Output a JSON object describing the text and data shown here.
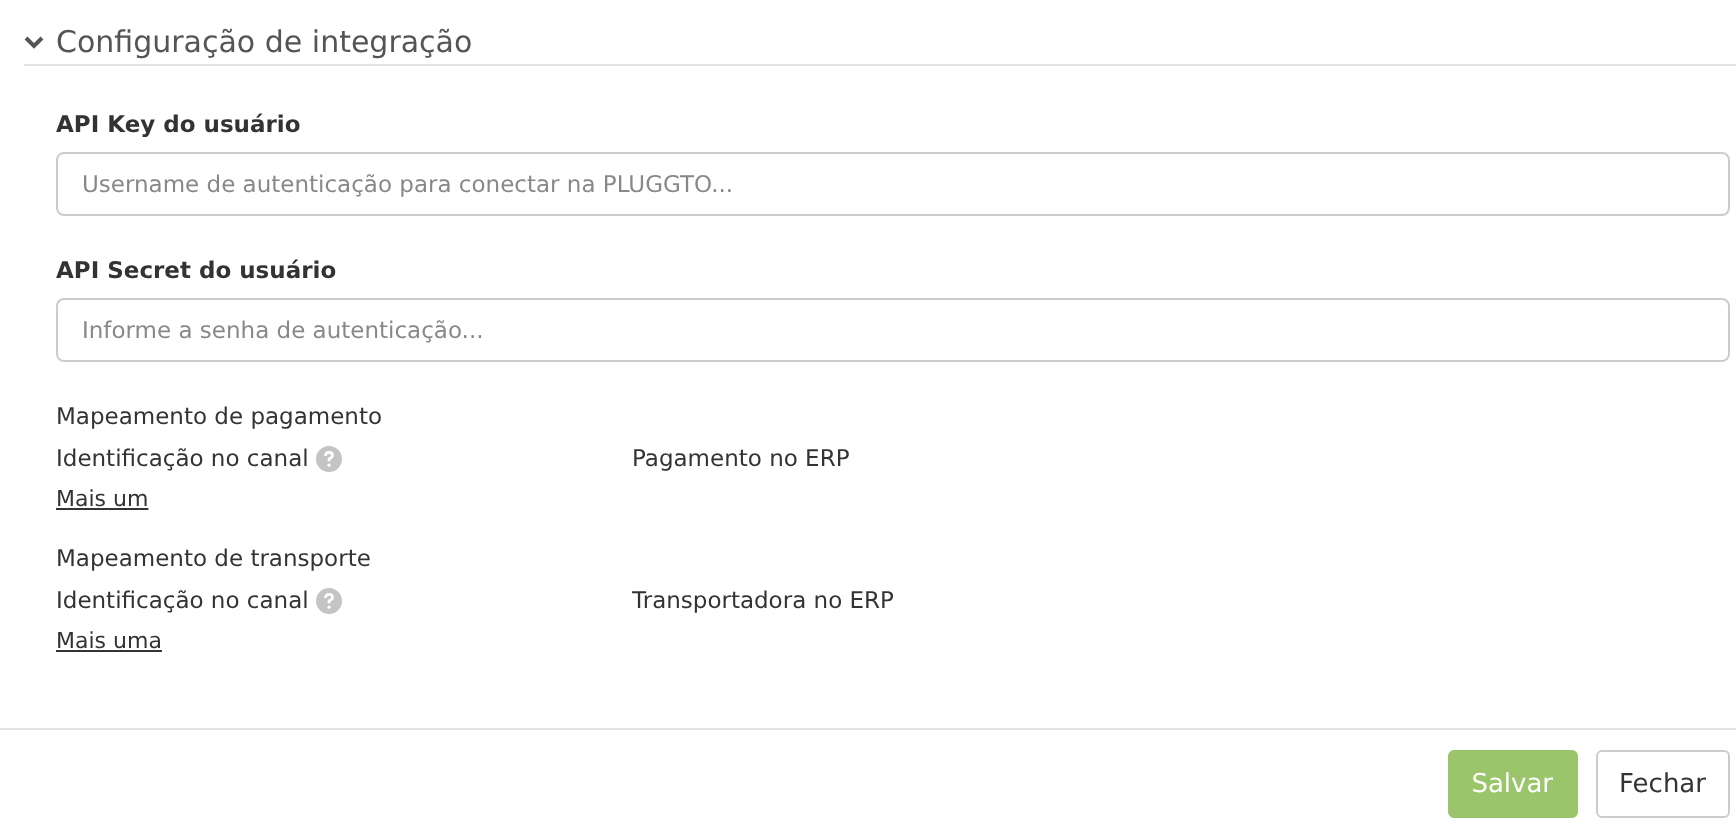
{
  "section": {
    "title": "Configuração de integração",
    "expanded": true
  },
  "fields": [
    {
      "label": "API Key do usuário",
      "placeholder": "Username de autenticação para conectar na PLUGGTO..."
    },
    {
      "label": "API Secret do usuário",
      "placeholder": "Informe a senha de autenticação..."
    }
  ],
  "mappings": [
    {
      "title": "Mapeamento de pagamento",
      "column_1": "Identificação no canal",
      "column_2": "Pagamento no ERP",
      "link": "Mais um"
    },
    {
      "title": "Mapeamento de transporte",
      "column_1": "Identificação no canal",
      "column_2": "Transportadora no ERP",
      "link": "Mais uma"
    }
  ],
  "buttons": [
    {
      "label": "Salvar",
      "kind": "primary"
    },
    {
      "label": "Fechar",
      "kind": "default"
    }
  ]
}
